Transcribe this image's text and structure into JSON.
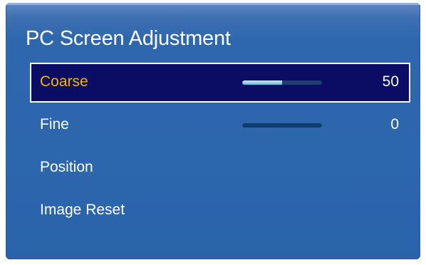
{
  "menu": {
    "title": "PC Screen Adjustment",
    "items": [
      {
        "label": "Coarse",
        "value": "50",
        "slider_fraction": 0.5,
        "selected": true
      },
      {
        "label": "Fine",
        "value": "0",
        "slider_fraction": 0.0,
        "selected": false
      },
      {
        "label": "Position",
        "selected": false
      },
      {
        "label": "Image Reset",
        "selected": false
      }
    ]
  },
  "colors": {
    "panel_background": "#2c66ad",
    "selected_background": "#0a0d63",
    "selected_label": "#f5b400",
    "text": "#ffffff",
    "slider_fill": "#8fd3f2",
    "slider_track": "#0e3d6e"
  }
}
